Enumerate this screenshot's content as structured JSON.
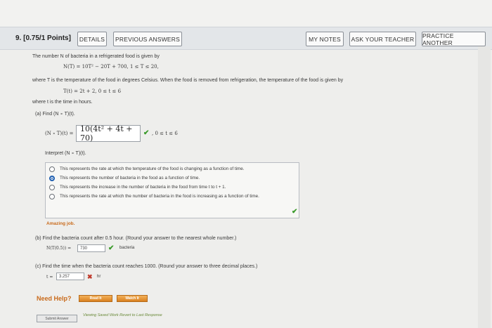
{
  "question": {
    "number": "9. [0.75/1 Points]",
    "buttons": {
      "details": "DETAILS",
      "previous_answers": "PREVIOUS ANSWERS",
      "my_notes": "MY NOTES",
      "ask_teacher": "ASK YOUR TEACHER",
      "practice_another": "PRACTICE ANOTHER"
    },
    "intro": "The number N of bacteria in a refrigerated food is given by",
    "formula_n": "N(T) = 10T² − 20T + 700,  1 ≤ T ≤ 20,",
    "where_t": "where T is the temperature of the food in degrees Celsius. When the food is removed from refrigeration, the temperature of the food is given by",
    "formula_t": "T(t) = 2t + 2,  0 ≤ t ≤ 6",
    "where_time": "where t is the time in hours."
  },
  "part_a": {
    "label": "(a)  Find (N ∘ T)(t).",
    "lhs": "(N ∘ T)(t) =",
    "answer": "10(4t² + 4t + 70)",
    "domain": ",  0 ≤ t ≤ 6",
    "interpret": "Interpret (N ∘ T)(t).",
    "options": [
      "This represents the rate at which the temperature of the food is changing as a function of time.",
      "This represents the number of bacteria in the food as a function of time.",
      "This represents the increase in the number of bacteria in the food from time t to t + 1.",
      "This represents the rate at which the number of bacteria in the food is increasing as a function of time."
    ],
    "selected_index": 1,
    "feedback": "Amazing job."
  },
  "part_b": {
    "label": "(b)  Find the bacteria count after 0.5 hour. (Round your answer to the nearest whole number.)",
    "lhs": "N(T(0.5)) =",
    "answer": "730",
    "unit": "bacteria"
  },
  "part_c": {
    "label": "(c)  Find the time when the bacteria count reaches 1000. (Round your answer to three decimal places.)",
    "lhs": "t =",
    "answer": "3.257",
    "unit": "hr"
  },
  "help": {
    "title": "Need Help?",
    "read_it": "Read It",
    "watch_it": "Watch It"
  },
  "footer": {
    "submit": "Submit Answer",
    "saved_text": "Viewing Saved Work Revert to Last Response"
  },
  "colors": {
    "accent_blue": "#1f5fb0",
    "correct_green": "#3a9a2a",
    "wrong_red": "#c0392b",
    "help_orange": "#c96a1a"
  }
}
